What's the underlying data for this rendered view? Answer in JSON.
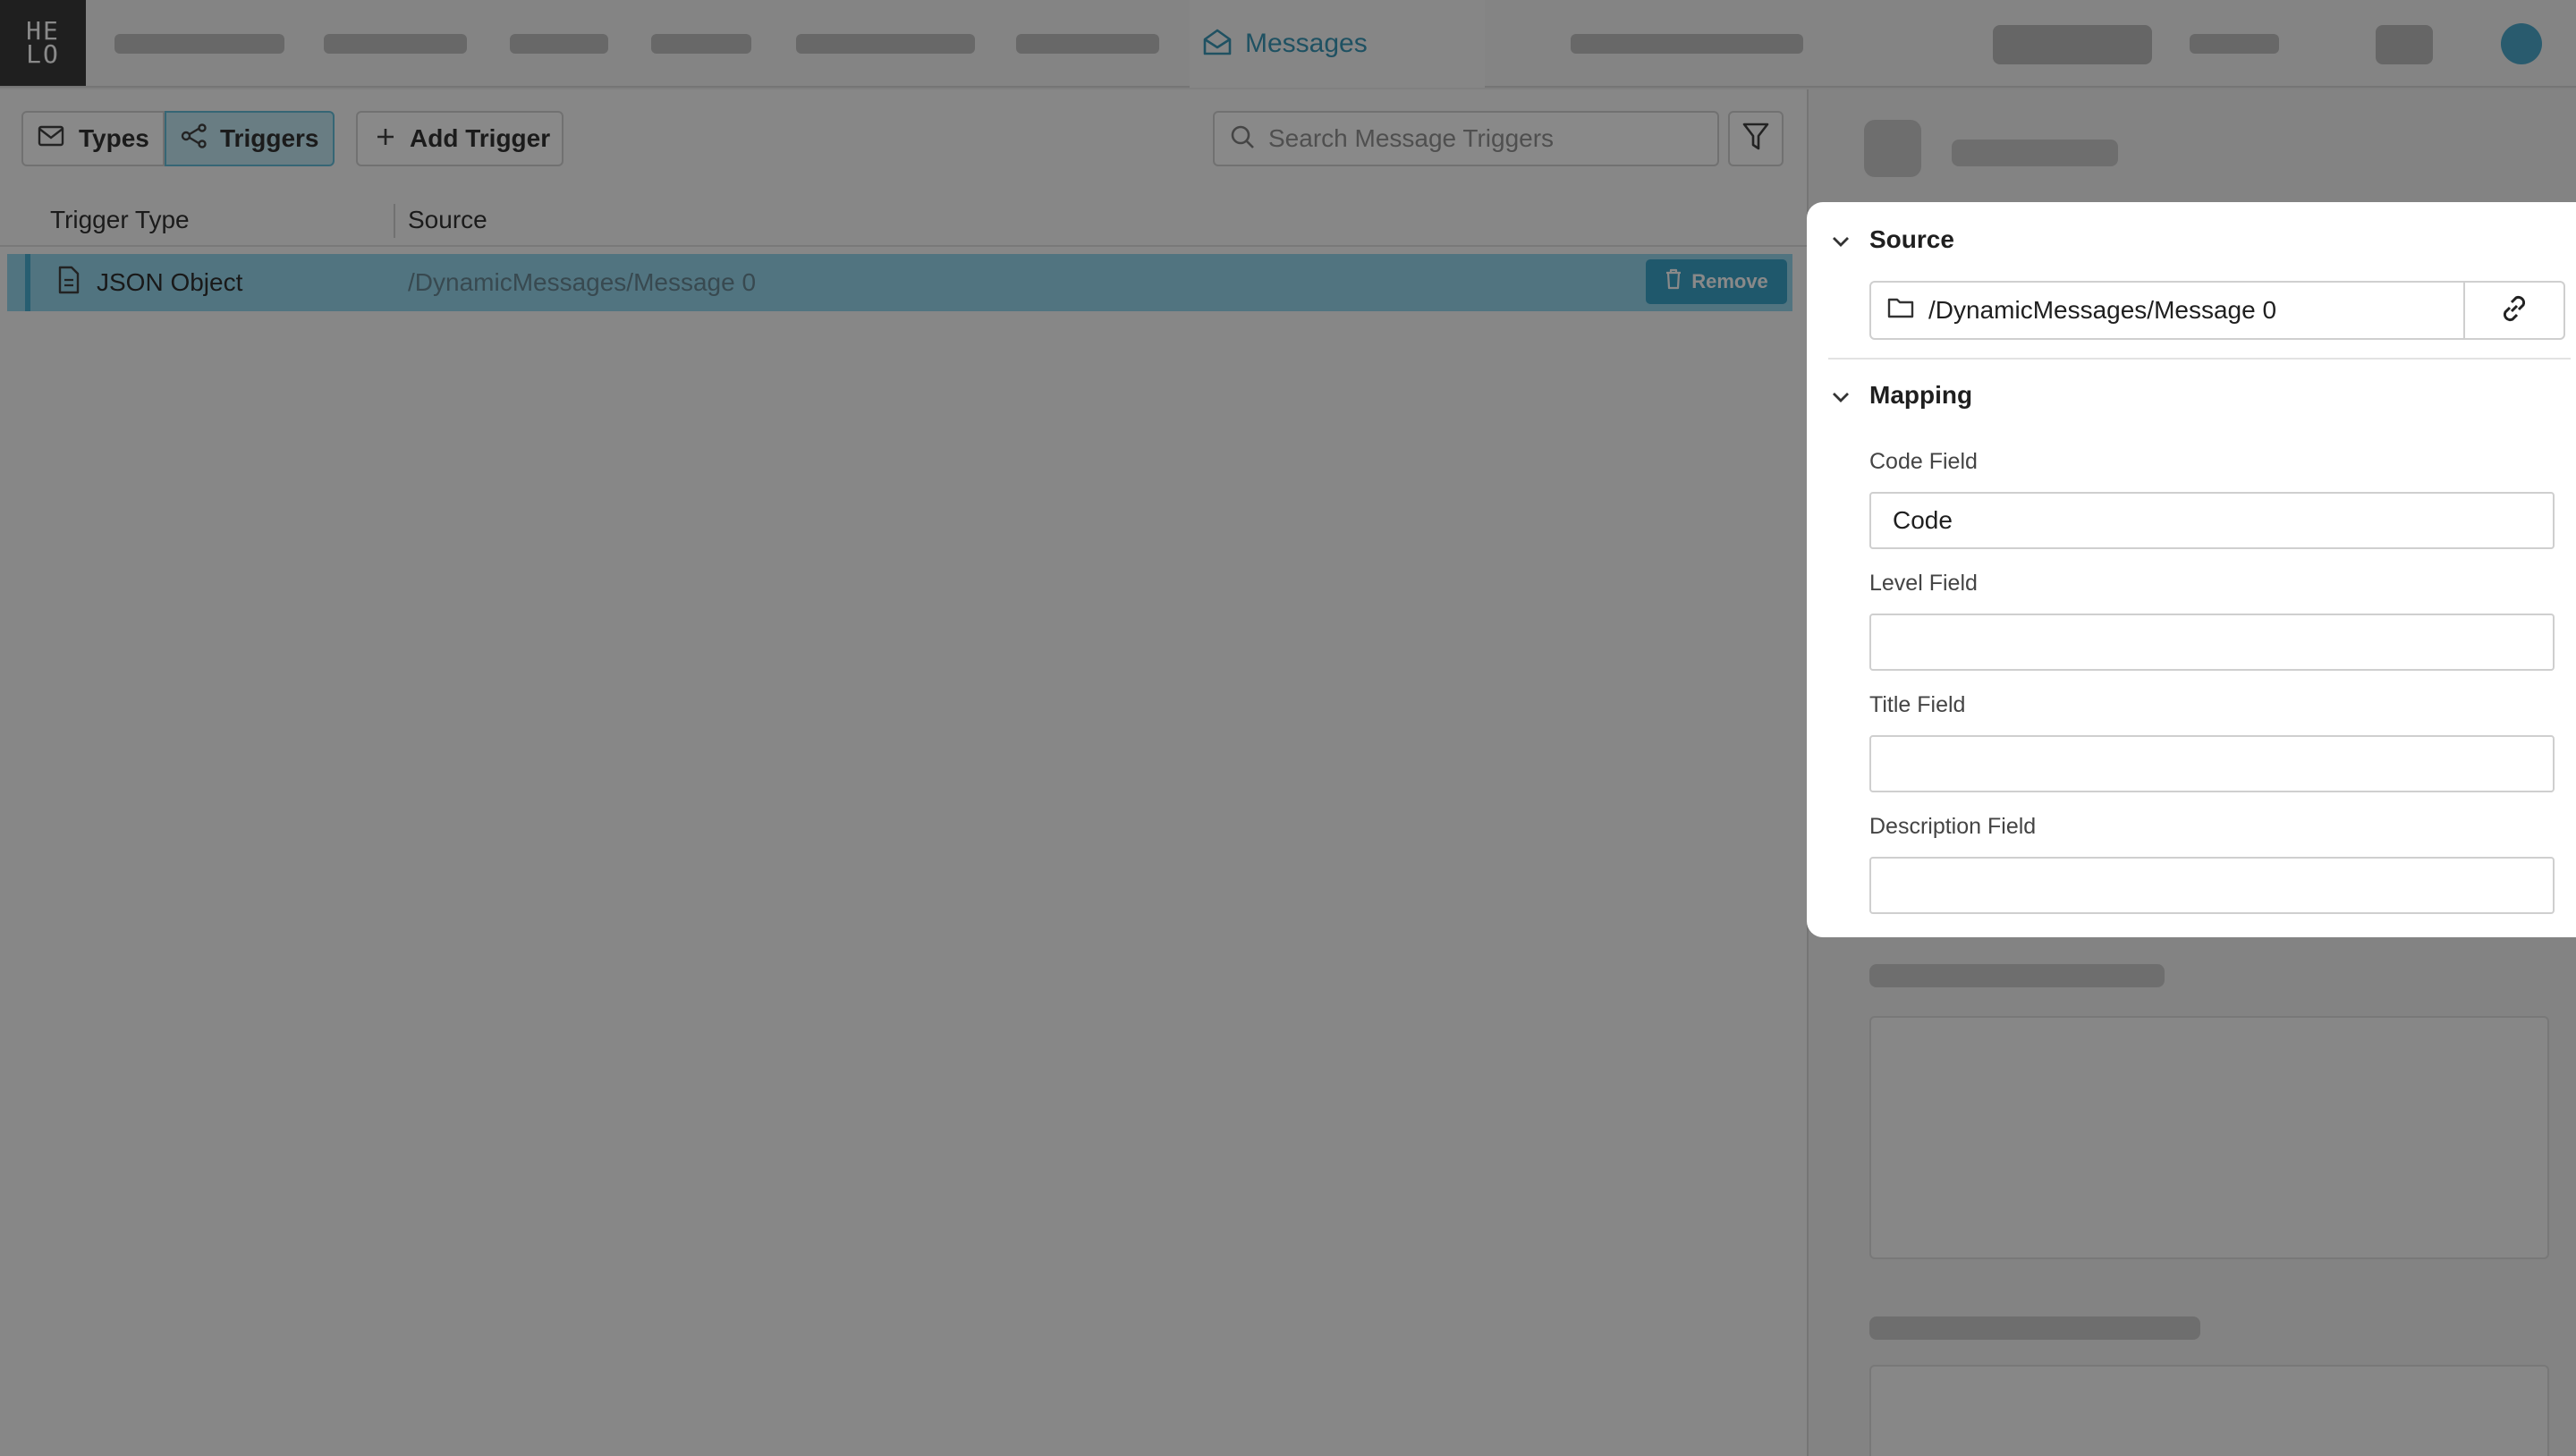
{
  "app": {
    "logo_text": "HE\nLO",
    "active_tab": {
      "label": "Messages",
      "icon": "envelope-open-icon",
      "color": "#2a8fb0"
    },
    "blurred_tabs": 7
  },
  "toolbar": {
    "types_label": "Types",
    "triggers_label": "Triggers",
    "add_trigger_label": "Add Trigger",
    "search_placeholder": "Search Message Triggers"
  },
  "table": {
    "columns": [
      "Trigger Type",
      "Source"
    ],
    "rows": [
      {
        "type": "JSON Object",
        "source": "/DynamicMessages/Message 0",
        "action": "Remove",
        "selected": true
      }
    ]
  },
  "popover": {
    "source_section": {
      "title": "Source",
      "value": "/DynamicMessages/Message 0"
    },
    "mapping_section": {
      "title": "Mapping",
      "fields": [
        {
          "label": "Code Field",
          "value": "Code"
        },
        {
          "label": "Level Field",
          "value": ""
        },
        {
          "label": "Title Field",
          "value": ""
        },
        {
          "label": "Description Field",
          "value": ""
        }
      ]
    }
  },
  "colors": {
    "accent": "#2a9cc4",
    "selected_row": "#8fd4ec",
    "overlay": "rgba(20,20,20,0.50)"
  }
}
